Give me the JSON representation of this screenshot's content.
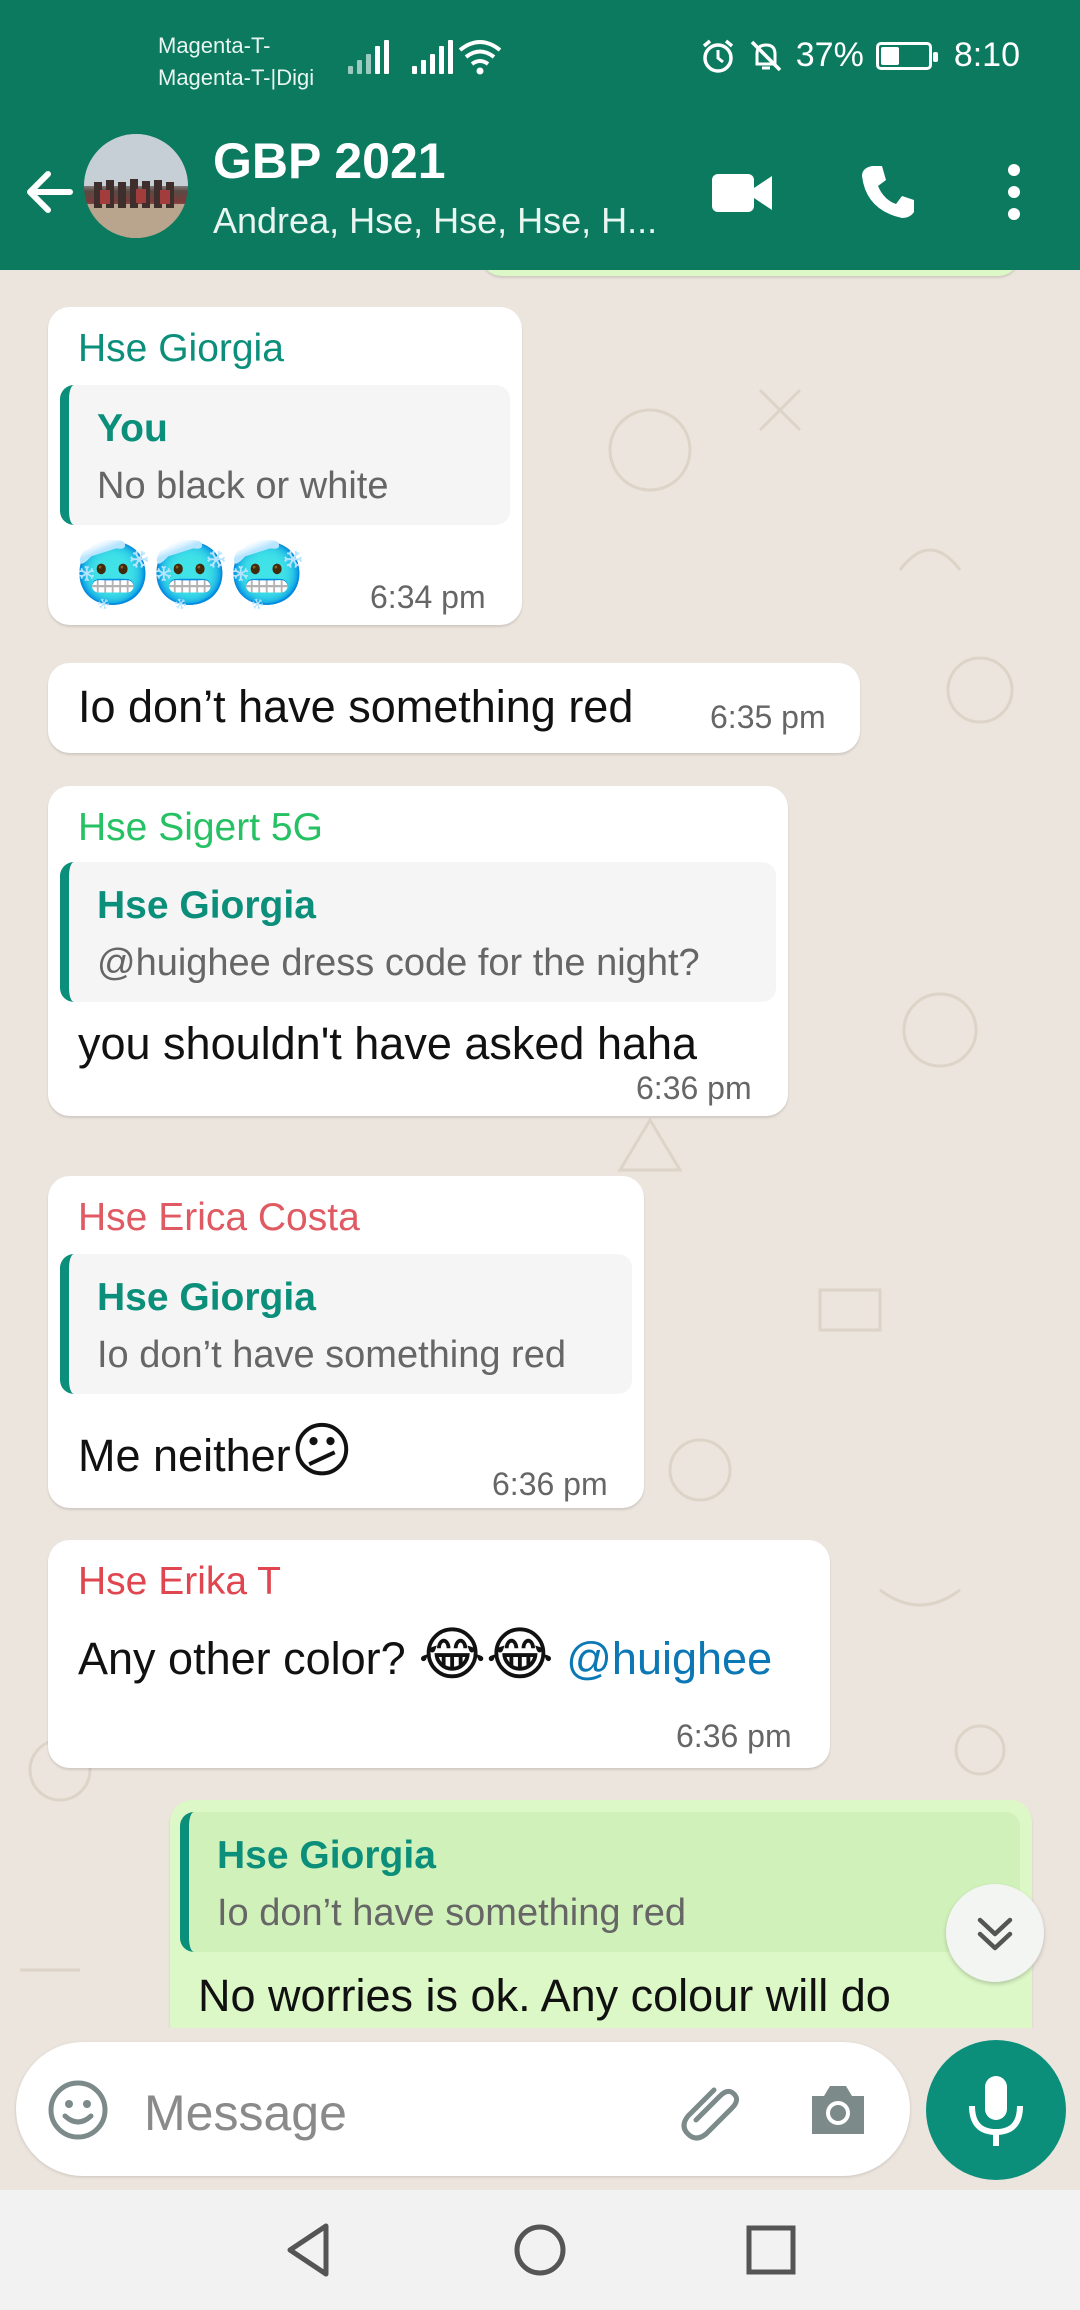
{
  "status_bar": {
    "carrier_1": "Magenta-T-",
    "carrier_2": "Magenta-T-|Digi",
    "battery": "37%",
    "battery_level": 0.37,
    "time": "8:10",
    "icons": [
      "signal-icon",
      "signal-roaming-icon",
      "wifi-icon",
      "alarm-icon",
      "mute-icon",
      "battery-icon"
    ]
  },
  "header": {
    "title": "GBP 2021",
    "subtitle": "Andrea, Hse, Hse, Hse, H...",
    "icons": [
      "back-arrow-icon",
      "video-call-icon",
      "voice-call-icon",
      "more-vert-icon"
    ]
  },
  "messages": [
    {
      "sender": "Hse Giorgia",
      "sender_color": "#0b8f7a",
      "quote_name": "You",
      "quote_text": "No black or white",
      "text": "🥶🥶🥶",
      "time": "6:34 pm"
    },
    {
      "text": "Io don’t have something red",
      "time": "6:35 pm"
    },
    {
      "sender": "Hse Sigert 5G",
      "sender_color": "#25c163",
      "quote_name": "Hse Giorgia",
      "quote_text": "@huighee dress code for the night?",
      "text": "you shouldn't have asked haha",
      "time": "6:36 pm"
    },
    {
      "sender": "Hse Erica Costa",
      "sender_color": "#e05a63",
      "quote_name": "Hse Giorgia",
      "quote_text": "Io don’t have something red",
      "text": "Me neither",
      "emoji": "😕",
      "time": "6:36 pm"
    },
    {
      "sender": "Hse Erika T",
      "sender_color": "#e0464f",
      "text": "Any other color? ",
      "emoji": "😂😂",
      "mention": "@huighee",
      "time": "6:36 pm"
    },
    {
      "outgoing": true,
      "quote_name": "Hse Giorgia",
      "quote_text": "Io don’t have something red",
      "text": "No worries is ok. Any colour will do"
    }
  ],
  "composer": {
    "placeholder": "Message",
    "icons": [
      "emoji-icon",
      "attach-icon",
      "camera-icon",
      "mic-icon"
    ]
  },
  "colors": {
    "header_bg": "#0b7a5f",
    "chat_bg": "#ece5dd",
    "outgoing_bubble": "#dcf8c6",
    "accent": "#0b8f7a"
  }
}
